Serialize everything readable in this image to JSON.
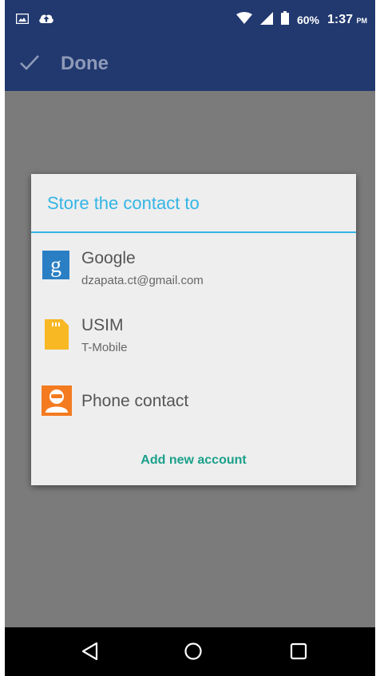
{
  "status_bar": {
    "battery_percent": "60%",
    "time": "1:37",
    "am_pm": "PM",
    "icons": [
      "image-icon",
      "cloud-upload-icon",
      "wifi-icon",
      "signal-icon",
      "battery-icon"
    ]
  },
  "toolbar": {
    "done_label": "Done",
    "icon": "check-icon"
  },
  "dialog": {
    "title": "Store the contact to",
    "accounts": [
      {
        "name": "Google",
        "detail": "dzapata.ct@gmail.com",
        "icon": "google-icon"
      },
      {
        "name": "USIM",
        "detail": "T-Mobile",
        "icon": "sim-card-icon"
      },
      {
        "name": "Phone contact",
        "icon": "phone-contact-icon"
      }
    ],
    "add_account_label": "Add new account"
  },
  "navigation": {
    "icons": [
      "back-icon",
      "home-icon",
      "recents-icon"
    ]
  },
  "colors": {
    "app_bar": "#22396f",
    "accent": "#33b5e5",
    "button_text": "#1aa08a",
    "google_blue": "#2a7fc4",
    "sim_yellow": "#f8b824",
    "phone_orange": "#f47b20"
  }
}
